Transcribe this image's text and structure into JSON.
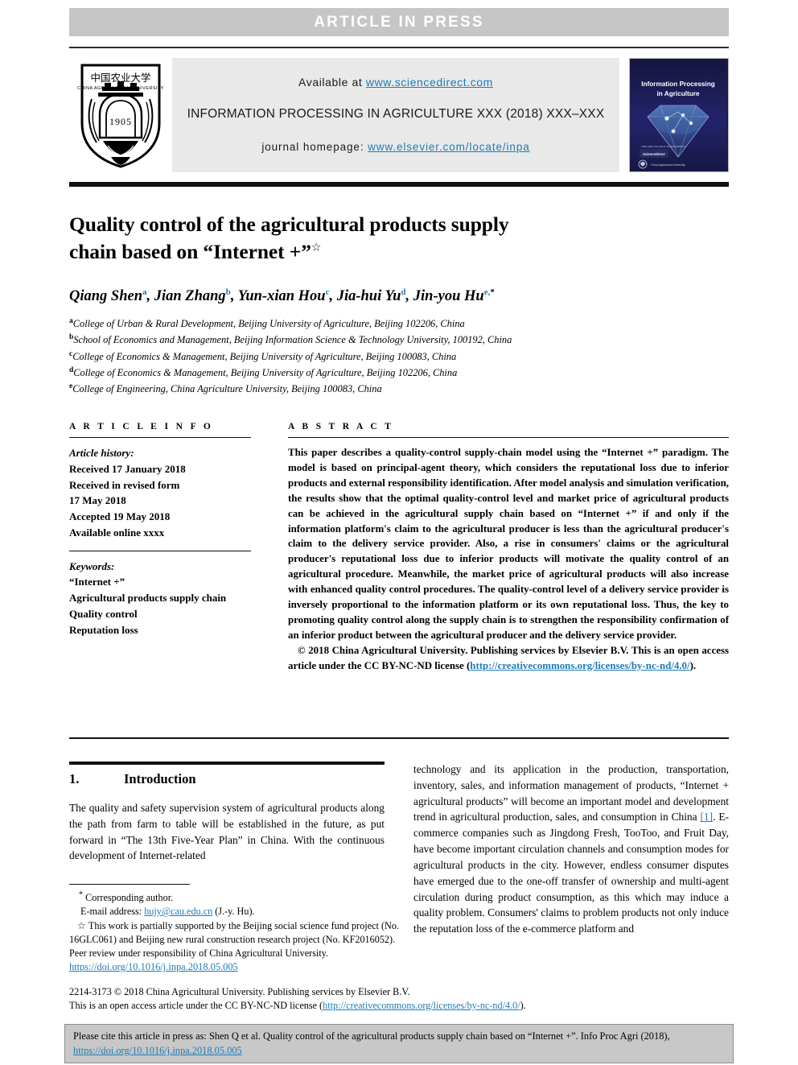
{
  "banner": {
    "text": "ARTICLE  IN  PRESS"
  },
  "journal_header": {
    "available_prefix": "Available at ",
    "available_link": "www.sciencedirect.com",
    "journal_line": "INFORMATION PROCESSING IN AGRICULTURE XXX (2018) XXX–XXX",
    "homepage_prefix": "journal homepage: ",
    "homepage_link": "www.elsevier.com/locate/inpa",
    "logo_alt": "China Agricultural University",
    "logo_chinese": "中国农业大学",
    "logo_english": "CHINA AGRICULTURAL UNIVERSITY",
    "logo_year": "1905",
    "cover_title_line1": "Information Processing",
    "cover_title_line2": "in Agriculture",
    "cover_publisher": "China Agricultural University",
    "cover_imprint": "ScienceDirect"
  },
  "article": {
    "title": "Quality control of the agricultural products supply chain based on “Internet +”",
    "title_line1": "Quality control of the agricultural products supply",
    "title_line2": "chain based on “Internet +”",
    "title_marker": "☆",
    "authors": [
      {
        "name": "Qiang Shen",
        "sup": "a"
      },
      {
        "name": "Jian Zhang",
        "sup": "b"
      },
      {
        "name": "Yun-xian Hou",
        "sup": "c"
      },
      {
        "name": "Jia-hui Yu",
        "sup": "d"
      },
      {
        "name": "Jin-you Hu",
        "sup": "e,",
        "sup_ast": "*"
      }
    ],
    "affiliations": [
      {
        "mark": "a",
        "text": "College of Urban & Rural Development, Beijing University of Agriculture, Beijing 102206, China"
      },
      {
        "mark": "b",
        "text": "School of Economics and Management, Beijing Information Science & Technology University, 100192, China"
      },
      {
        "mark": "c",
        "text": "College of Economics & Management, Beijing University of Agriculture, Beijing 100083, China"
      },
      {
        "mark": "d",
        "text": "College of Economics & Management, Beijing University of Agriculture, Beijing 102206, China"
      },
      {
        "mark": "e",
        "text": "College of Engineering, China Agriculture University, Beijing 100083, China"
      }
    ]
  },
  "article_info": {
    "label": "A R T I C L E   I N F O",
    "history_label": "Article history:",
    "history": [
      "Received 17 January 2018",
      "Received in revised form",
      "17 May 2018",
      "Accepted 19 May 2018",
      "Available online xxxx"
    ],
    "keywords_label": "Keywords:",
    "keywords": [
      "“Internet +”",
      "Agricultural products supply chain",
      "Quality control",
      "Reputation loss"
    ]
  },
  "abstract": {
    "label": "A B S T R A C T",
    "body": "This paper describes a quality-control supply-chain model using the “Internet +” paradigm. The model is based on principal-agent theory, which considers the reputational loss due to inferior products and external responsibility identification. After model analysis and simulation verification, the results show that the optimal quality-control level and market price of agricultural products can be achieved in the agricultural supply chain based on “Internet +” if and only if the information platform's claim to the agricultural producer is less than the agricultural producer's claim to the delivery service provider. Also, a rise in consumers' claims or the agricultural producer's reputational loss due to inferior products will motivate the quality control of an agricultural procedure. Meanwhile, the market price of agricultural products will also increase with enhanced quality control procedures. The quality-control level of a delivery service provider is inversely proportional to the information platform or its own reputational loss. Thus, the key to promoting quality control along the supply chain is to strengthen the responsibility confirmation of an inferior product between the agricultural producer and the delivery service provider.",
    "copyright_prefix": "© 2018 China Agricultural University. Publishing services by Elsevier B.V. This is an open access article under the CC BY-NC-ND license (",
    "copyright_link": "http://creativecommons.org/licenses/by-nc-nd/4.0/",
    "copyright_suffix": ")."
  },
  "introduction": {
    "number": "1.",
    "heading": "Introduction",
    "left_paragraph": "The quality and safety supervision system of agricultural products along the path from farm to table will be established in the future, as put forward in “The 13th Five-Year Plan” in China. With the continuous development of Internet-related",
    "right_part1": "technology and its application in the production, transportation, inventory, sales, and information management of products, “Internet + agricultural products” will become an important model and development trend in agricultural production, sales, and consumption in China ",
    "right_ref": "[1]",
    "right_part2": ". E-commerce companies such as Jingdong Fresh, TooToo, and Fruit Day, have become important circulation channels and consumption modes for agricultural products in the city. However, endless consumer disputes have emerged due to the one-off transfer of ownership and multi-agent circulation during product consumption, as this which may induce a quality problem. Consumers' claims to problem products not only induce the reputation loss of the e-commerce platform and"
  },
  "footnotes": {
    "corresponding_marker": "*",
    "corresponding_text": "Corresponding author.",
    "email_label": "E-mail address: ",
    "email_link": "hujy@cau.edu.cn",
    "email_suffix": " (J.-y. Hu).",
    "funding_marker": "☆",
    "funding_text": "This work is partially supported by the Beijing social science fund project (No. 16GLC061) and Beijing new rural construction research project (No. KF2016052).",
    "peer_review": "Peer review under responsibility of China Agricultural University.",
    "doi_link": "https://doi.org/10.1016/j.inpa.2018.05.005",
    "issn_copyright": "2214-3173 © 2018 China Agricultural University. Publishing services by Elsevier B.V.",
    "license_prefix": "This is an open access article under the CC BY-NC-ND license (",
    "license_link": "http://creativecommons.org/licenses/by-nc-nd/4.0/",
    "license_suffix": ")."
  },
  "cite_box": {
    "text_part1": "Please cite this article in press as: Shen Q et al. Quality control of the agricultural products supply chain based on “Internet +”. Info Proc Agri (2018), ",
    "link": "https://doi.org/10.1016/j.inpa.2018.05.005"
  },
  "colors": {
    "link": "#1f7bb6",
    "banner_bg": "#c6c6c6",
    "masthead_bg": "#e9e9e9",
    "cite_bg": "#c8c8c8",
    "rule_dark": "#111111",
    "cover_bg": "#1b1b4a"
  }
}
